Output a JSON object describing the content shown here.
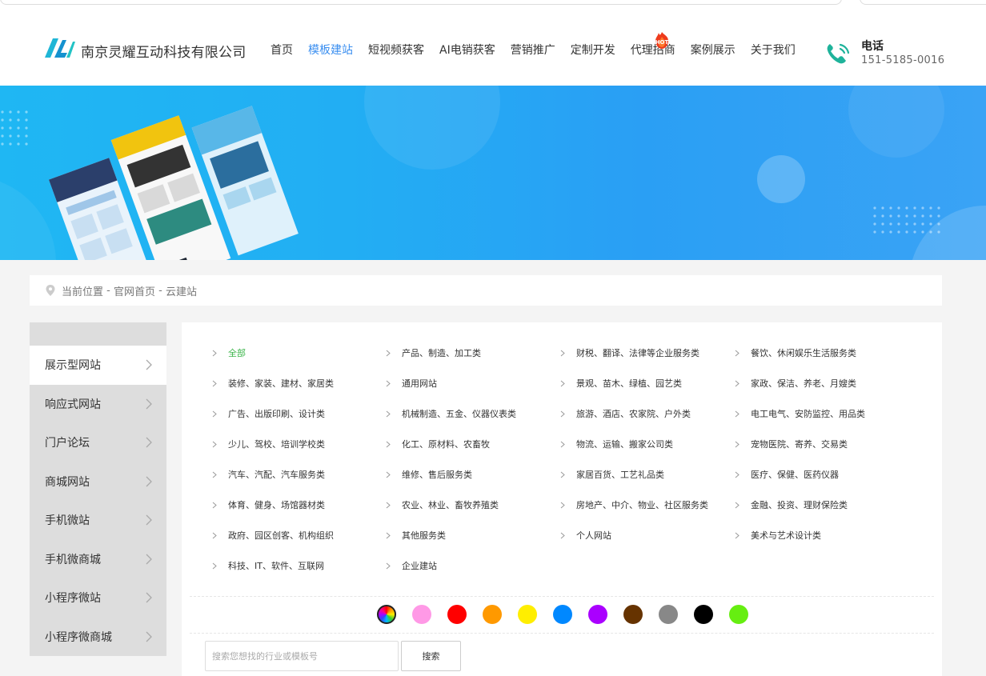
{
  "header": {
    "company_name": "南京灵耀互动科技有限公司",
    "nav": [
      {
        "label": "首页"
      },
      {
        "label": "模板建站"
      },
      {
        "label": "短视频获客"
      },
      {
        "label": "AI电销获客"
      },
      {
        "label": "营销推广"
      },
      {
        "label": "定制开发"
      },
      {
        "label": "代理招商"
      },
      {
        "label": "案例展示"
      },
      {
        "label": "关于我们"
      }
    ],
    "active_nav": "模板建站",
    "hot_badge": "HOT",
    "phone_label": "电话",
    "phone_number": "151-5185-0016"
  },
  "breadcrumb": {
    "label": "当前位置",
    "sep": " - ",
    "home": "官网首页",
    "current": "云建站"
  },
  "sidebar": {
    "items": [
      {
        "label": "展示型网站"
      },
      {
        "label": "响应式网站"
      },
      {
        "label": "门户论坛"
      },
      {
        "label": "商城网站"
      },
      {
        "label": "手机微站"
      },
      {
        "label": "手机微商城"
      },
      {
        "label": "小程序微站"
      },
      {
        "label": "小程序微商城"
      }
    ]
  },
  "categories": [
    {
      "label": "全部",
      "active": true
    },
    {
      "label": "产品、制造、加工类"
    },
    {
      "label": "财税、翻译、法律等企业服务类"
    },
    {
      "label": "餐饮、休闲娱乐生活服务类"
    },
    {
      "label": "装修、家装、建材、家居类"
    },
    {
      "label": "通用网站"
    },
    {
      "label": "景观、苗木、绿植、园艺类"
    },
    {
      "label": "家政、保洁、养老、月嫂类"
    },
    {
      "label": "广告、出版印刷、设计类"
    },
    {
      "label": "机械制造、五金、仪器仪表类"
    },
    {
      "label": "旅游、酒店、农家院、户外类"
    },
    {
      "label": "电工电气、安防监控、用品类"
    },
    {
      "label": "少儿、驾校、培训学校类"
    },
    {
      "label": "化工、原材料、农畜牧"
    },
    {
      "label": "物流、运输、搬家公司类"
    },
    {
      "label": "宠物医院、寄养、交易类"
    },
    {
      "label": "汽车、汽配、汽车服务类"
    },
    {
      "label": "维修、售后服务类"
    },
    {
      "label": "家居百货、工艺礼品类"
    },
    {
      "label": "医疗、保健、医药仪器"
    },
    {
      "label": "体育、健身、场馆器材类"
    },
    {
      "label": "农业、林业、畜牧养殖类"
    },
    {
      "label": "房地产、中介、物业、社区服务类"
    },
    {
      "label": "金融、投资、理财保险类"
    },
    {
      "label": "政府、园区创客、机构组织"
    },
    {
      "label": "其他服务类"
    },
    {
      "label": "个人网站"
    },
    {
      "label": "美术与艺术设计类"
    },
    {
      "label": "科技、IT、软件、互联网"
    },
    {
      "label": "企业建站"
    }
  ],
  "color_filters": [
    {
      "name": "all-colors",
      "color": "multicolor"
    },
    {
      "name": "pink",
      "color": "#ff99e6"
    },
    {
      "name": "red",
      "color": "#ff0000"
    },
    {
      "name": "orange",
      "color": "#ff9900"
    },
    {
      "name": "yellow",
      "color": "#ffee00"
    },
    {
      "name": "blue",
      "color": "#0088ff"
    },
    {
      "name": "purple",
      "color": "#aa00ff"
    },
    {
      "name": "brown",
      "color": "#663300"
    },
    {
      "name": "gray",
      "color": "#888888"
    },
    {
      "name": "black",
      "color": "#000000"
    },
    {
      "name": "green",
      "color": "#66ee11"
    }
  ],
  "search": {
    "placeholder": "搜索您想找的行业或模板号",
    "button_label": "搜索"
  },
  "colors": {
    "accent": "#3b8ff0",
    "active_category": "#3bb54a",
    "logo": "#19a3d1",
    "phone_icon": "#1fb39b"
  }
}
